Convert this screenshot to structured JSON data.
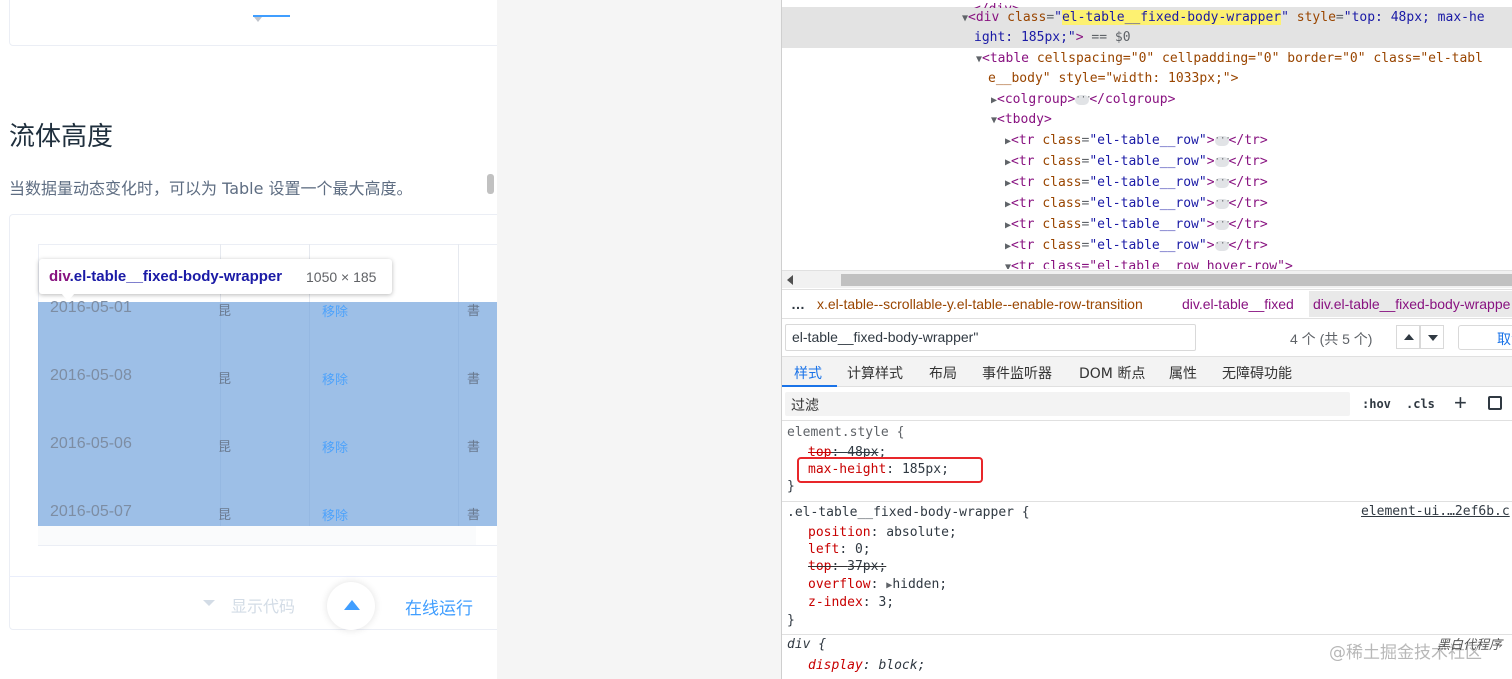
{
  "doc": {
    "section_title": "流体高度",
    "section_desc": "当数据量动态变化时，可以为 Table 设置一个最大高度。",
    "rows": [
      {
        "date": "2016-05-01",
        "glyph": "昆",
        "action": "移除",
        "edge": "書"
      },
      {
        "date": "2016-05-08",
        "glyph": "昆",
        "action": "移除",
        "edge": "書"
      },
      {
        "date": "2016-05-06",
        "glyph": "昆",
        "action": "移除",
        "edge": "書"
      },
      {
        "date": "2016-05-07",
        "glyph": "昆",
        "action": "移除",
        "edge": "書"
      }
    ],
    "tooltip": {
      "tag": "div",
      "class": ".el-table__fixed-body-wrapper",
      "dims": "1050 × 185"
    },
    "show_code": "显示代码",
    "run_online": "在线运行"
  },
  "devtools": {
    "dom": {
      "sel_tag": "div",
      "sel_class_attr": "class",
      "sel_class_val": "el-table__fixed-body-wrapper",
      "sel_style_attr": "style",
      "sel_style_val_1": "\"top: 48px; max-he",
      "sel_style_val_2": "ight: 185px;\"",
      "sel_marker": " == $0",
      "table_line_1": "cellspacing=\"0\" cellpadding=\"0\" border=\"0\" class=\"el-tabl",
      "table_line_2": "e__body\" style=\"width: 1033px;\">",
      "colgroup": "colgroup",
      "tbody": "tbody",
      "row_class": "el-table__row",
      "row_count": 6,
      "last_row": "<tr class=\"el-table__row hover-row\">"
    },
    "breadcrumbs": [
      "x.el-table--scrollable-y.el-table--enable-row-transition",
      "div.el-table__fixed",
      "div.el-table__fixed-body-wrappe"
    ],
    "breadcrumb_more": "…",
    "search": {
      "value": "el-table__fixed-body-wrapper\"",
      "count": "4 个 (共 5 个)",
      "cancel": "取消"
    },
    "tabs": [
      "样式",
      "计算样式",
      "布局",
      "事件监听器",
      "DOM 断点",
      "属性",
      "无障碍功能"
    ],
    "active_tab": 0,
    "filter": {
      "placeholder": "过滤",
      "hov": ":hov",
      "cls": ".cls"
    },
    "rules": {
      "element_style": {
        "selector": "element.style {",
        "top_prop": "top",
        "top_val": "48px",
        "maxh_prop": "max-height",
        "maxh_val": "185px"
      },
      "fixed_body": {
        "selector": ".el-table__fixed-body-wrapper {",
        "source": "element-ui.…2ef6b.c",
        "decls": [
          {
            "prop": "position",
            "val": "absolute"
          },
          {
            "prop": "left",
            "val": "0"
          },
          {
            "prop": "top",
            "val": "37px"
          },
          {
            "prop": "overflow",
            "val": "hidden"
          },
          {
            "prop": "z-index",
            "val": "3"
          }
        ]
      },
      "div_rule": {
        "selector": "div {",
        "prop": "display",
        "val": "block"
      },
      "close": "}"
    }
  },
  "watermark": "@稀土掘金技术社区",
  "watermark_overlay": "黑白代程序"
}
